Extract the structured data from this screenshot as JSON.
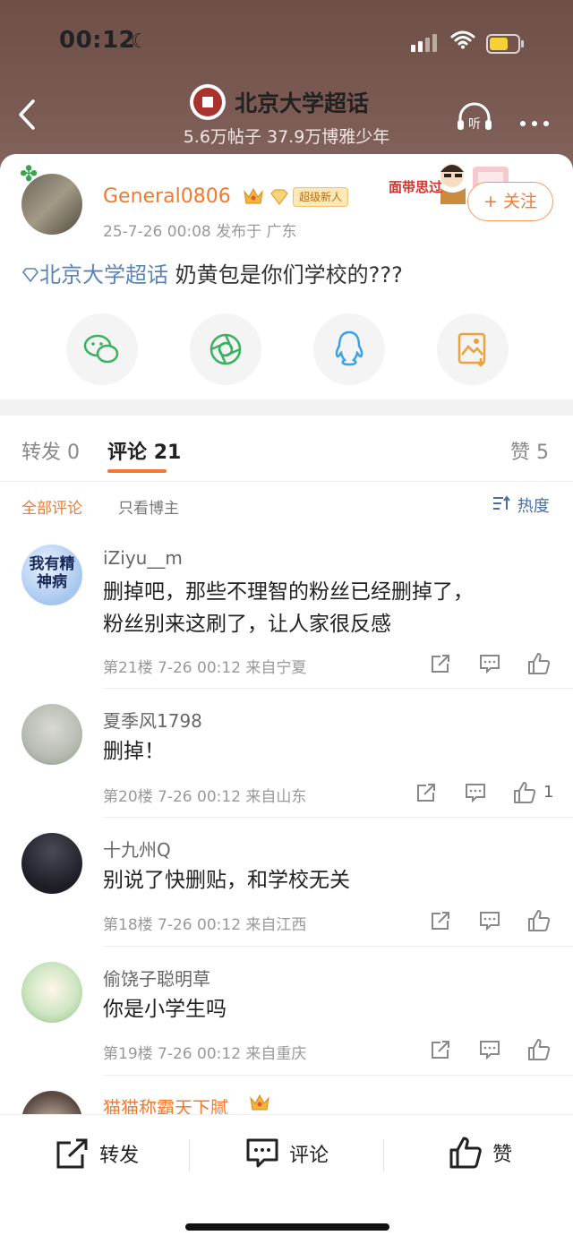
{
  "status_bar": {
    "time": "00:12"
  },
  "header": {
    "topic_title": "北京大学超话",
    "stats": "5.6万帖子 37.9万博雅少年"
  },
  "post": {
    "username": "General0806",
    "badge": "超级新人",
    "meta": "25-7-26 00:08  发布于 广东",
    "follow_label": "+ 关注",
    "sticker_text": "面带思过",
    "topic_link": "北京大学超话",
    "text": " 奶黄包是你们学校的???",
    "share_targets": [
      "wechat-icon",
      "moments-icon",
      "qq-icon",
      "save-image-icon"
    ]
  },
  "tabs": {
    "repost": {
      "label": "转发",
      "count": "0"
    },
    "comments": {
      "label": "评论",
      "count": "21"
    },
    "likes": {
      "label": "赞",
      "count": "5"
    }
  },
  "filters": {
    "all": "全部评论",
    "op_only": "只看博主",
    "sort": "热度"
  },
  "comments": [
    {
      "name": "iZiyu__m",
      "avatar_text": "我有精神病",
      "text": [
        "删掉吧，那些不理智的粉丝已经删掉了，",
        "粉丝别来这刷了，让人家很反感"
      ],
      "meta": "第21楼 7-26 00:12 来自宁夏",
      "likes": ""
    },
    {
      "name": "夏季风1798",
      "text": [
        "删掉！"
      ],
      "meta": "第20楼 7-26 00:12 来自山东",
      "likes": "1"
    },
    {
      "name": "十九州Q",
      "text": [
        "别说了快删贴，和学校无关"
      ],
      "meta": "第18楼 7-26 00:12 来自江西",
      "likes": ""
    },
    {
      "name": "偷饶子聪明草",
      "text": [
        "你是小学生吗"
      ],
      "meta": "第19楼 7-26 00:12 来自重庆",
      "likes": ""
    },
    {
      "name": "猫猫称霸天下腻"
    }
  ],
  "bottom_bar": {
    "repost": "转发",
    "comment": "评论",
    "like": "赞"
  },
  "colors": {
    "accent": "#f07a30",
    "header_bg": "#7a5a53",
    "link": "#5a84b8"
  }
}
